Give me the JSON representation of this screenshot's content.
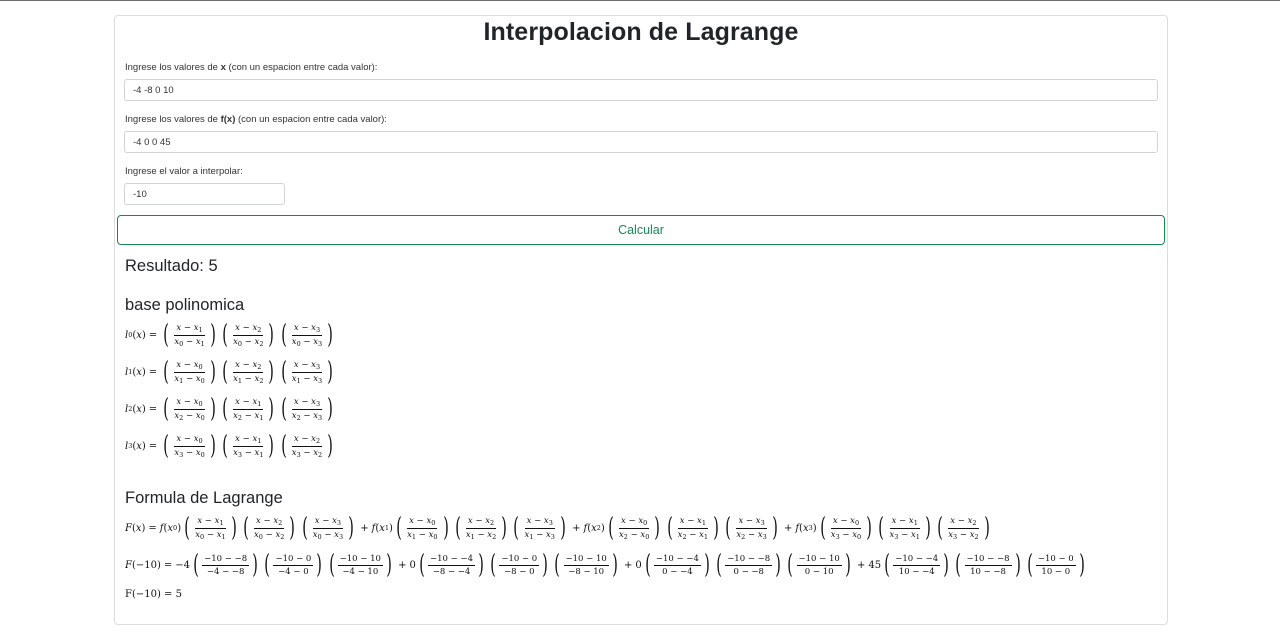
{
  "page": {
    "title": "Interpolacion de Lagrange"
  },
  "form": {
    "x_label_pre": "Ingrese los valores de ",
    "x_label_bold": "x",
    "x_label_post": " (con un espacion entre cada valor):",
    "x_value": "-4 -8 0 10",
    "fx_label_pre": "Ingrese los valores de ",
    "fx_label_bold": "f(x)",
    "fx_label_post": " (con un espacion entre cada valor):",
    "fx_value": "-4 0 0 45",
    "interp_label": "Ingrese el valor a interpolar:",
    "interp_value": "-10",
    "calc_button": "Calcular"
  },
  "results": {
    "resultado": "Resultado: 5",
    "base_heading": "base polinomica",
    "formula_heading": "Formula de Lagrange",
    "final_line": "F(−10) = 5"
  },
  "math": {
    "x_values": [
      "-4",
      "-8",
      "0",
      "10"
    ],
    "fx_values": [
      "-4",
      "0",
      "0",
      "45"
    ],
    "x_eval": "-10"
  }
}
